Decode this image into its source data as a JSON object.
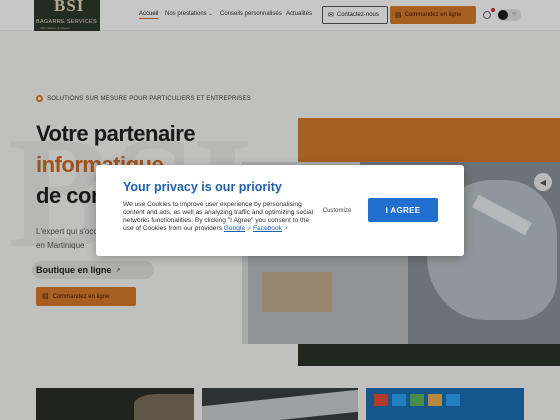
{
  "header": {
    "logo": {
      "mark": "BSI",
      "name": "BAGARRE SERVICES",
      "tagline": "Informatique & réseau"
    },
    "nav": [
      {
        "label": "Accueil"
      },
      {
        "label": "Nos prestations"
      },
      {
        "label": "Conseils personnalisés"
      },
      {
        "label": "Actualités"
      }
    ],
    "contact_label": "Contactez-nous",
    "order_label": "Commandez en ligne"
  },
  "hero": {
    "eyebrow": "SOLUTIONS SUR MESURE POUR PARTICULIERS ET ENTREPRISES",
    "line1": "Votre partenaire",
    "line2": "informatique",
    "line3": "de con",
    "body1": "L'expert qui s'occ",
    "body2": "en Martinique",
    "shop_label": "Boutique en ligne",
    "order_label": "Commandez en ligne",
    "watermark": "BSI"
  },
  "cookie": {
    "title": "Your privacy is our priority",
    "text": "We use Cookies to improve user experience by personalising content and ads, as well as analyzing traffic and optimizing social networks functionalities. By clicking \"I Agree\" you consent to the use of Cookies from our providers",
    "link_google": "Google",
    "link_facebook": "Facebook",
    "customize_label": "Customize",
    "agree_label": "I AGREE"
  },
  "colors": {
    "accent": "#d77a2c",
    "modal_title": "#1f5fa8",
    "agree_button": "#1f6ed0",
    "dark_green": "#2c3327"
  }
}
